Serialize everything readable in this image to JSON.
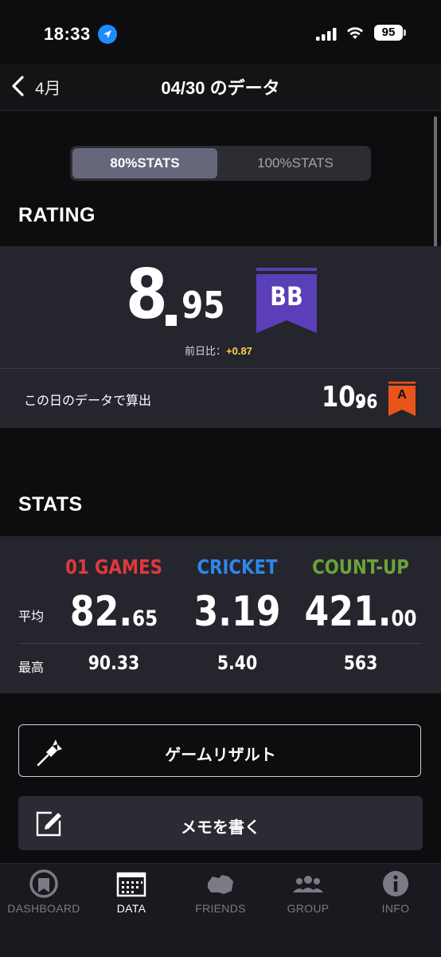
{
  "status_bar": {
    "time": "18:33",
    "battery": "95"
  },
  "nav": {
    "back_label": "4月",
    "title": "04/30 のデータ"
  },
  "segment": {
    "active": "80%STATS",
    "inactive": "100%STATS"
  },
  "rating": {
    "section_title": "RATING",
    "value_int": "8",
    "value_dec": "95",
    "badge": "BB",
    "diff_label": "前日比：",
    "diff_value": "+0.87",
    "day_label": "この日のデータで算出",
    "day_value_int": "10.",
    "day_value_dec": "96",
    "day_badge": "A"
  },
  "stats": {
    "section_title": "STATS",
    "row_avg_label": "平均",
    "row_max_label": "最高",
    "columns": [
      {
        "name": "01 GAMES",
        "color": "#e0393e",
        "avg_int": "82.",
        "avg_dec": "65",
        "max": "90.33"
      },
      {
        "name": "CRICKET",
        "color": "#2f86e8",
        "avg_int": "3.19",
        "avg_dec": "",
        "max": "5.40"
      },
      {
        "name": "COUNT-UP",
        "color": "#6aa437",
        "avg_int": "421.",
        "avg_dec": "00",
        "max": "563"
      }
    ]
  },
  "buttons": {
    "game_result": "ゲームリザルト",
    "memo": "メモを書く"
  },
  "tabs": [
    {
      "label": "DASHBOARD",
      "icon": "dashboard-icon"
    },
    {
      "label": "DATA",
      "icon": "data-icon"
    },
    {
      "label": "FRIENDS",
      "icon": "friends-icon"
    },
    {
      "label": "GROUP",
      "icon": "group-icon"
    },
    {
      "label": "INFO",
      "icon": "info-icon"
    }
  ],
  "colors": {
    "badge_bb": "#5a3fb8",
    "badge_a": "#e8541a",
    "diff": "#ffd54a"
  }
}
